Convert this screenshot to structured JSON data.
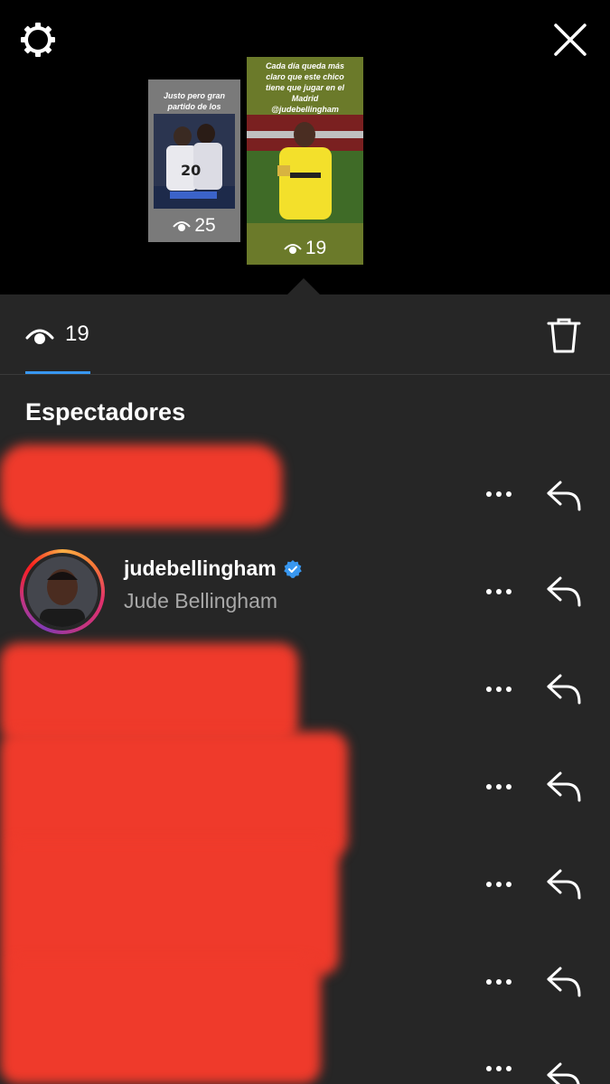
{
  "header": {
    "settings_icon": "gear-icon",
    "close_icon": "close-icon"
  },
  "stories": [
    {
      "caption": "Justo pero gran partido de los chicos",
      "views": "25"
    },
    {
      "caption": "Cada día queda más claro que este chico tiene que jugar en el Madrid @judebellingham",
      "views": "19"
    }
  ],
  "stats": {
    "viewer_count": "19",
    "delete_icon": "trash-icon"
  },
  "viewers_section": {
    "title": "Espectadores"
  },
  "viewers": [
    {
      "username": "",
      "full_name": "",
      "redacted": true
    },
    {
      "username": "judebellingham",
      "full_name": "Jude Bellingham",
      "verified": true,
      "redacted": false
    },
    {
      "username": "",
      "full_name": "",
      "redacted": true
    },
    {
      "username": "",
      "full_name": "",
      "redacted": true
    },
    {
      "username": "",
      "full_name": "",
      "redacted": true
    },
    {
      "username": "",
      "full_name": "",
      "redacted": true
    },
    {
      "username": "",
      "full_name": "",
      "redacted": true
    }
  ],
  "colors": {
    "accent": "#3897f0",
    "redaction": "#ef3a2b",
    "background": "#262626"
  }
}
